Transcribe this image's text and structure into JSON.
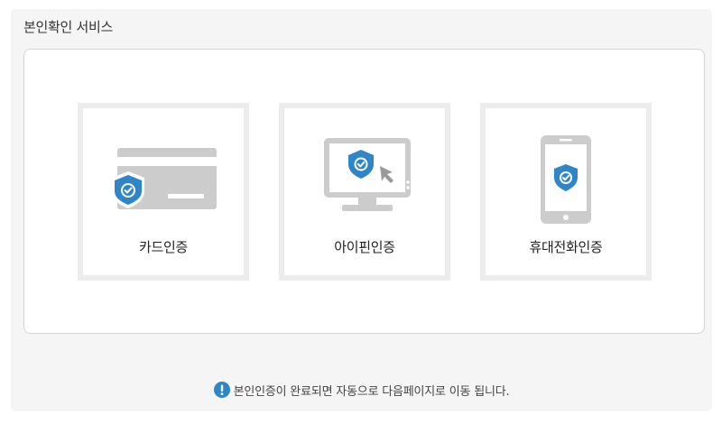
{
  "panel": {
    "title": "본인확인 서비스"
  },
  "options": [
    {
      "label": "카드인증",
      "icon": "credit-card-icon"
    },
    {
      "label": "아이핀인증",
      "icon": "monitor-icon"
    },
    {
      "label": "휴대전화인증",
      "icon": "smartphone-icon"
    }
  ],
  "notice": {
    "text": "본인인증이 완료되면 자동으로 다음페이지로 이동 됩니다.",
    "icon": "info-icon"
  },
  "colors": {
    "accent": "#2e86c9",
    "device_gray": "#cccccc",
    "tile_border": "#ececec",
    "panel_bg": "#f5f5f5"
  }
}
